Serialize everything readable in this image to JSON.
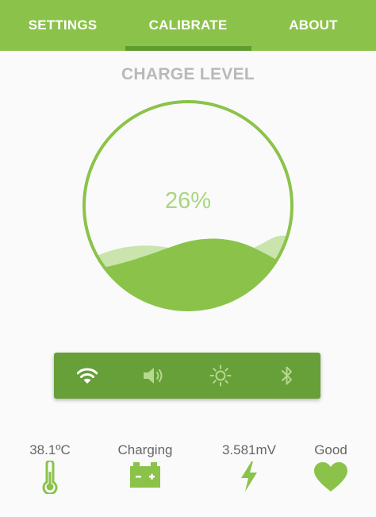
{
  "tabs": [
    {
      "label": "SETTINGS"
    },
    {
      "label": "CALIBRATE",
      "selected": true
    },
    {
      "label": "ABOUT"
    }
  ],
  "charge": {
    "title": "CHARGE LEVEL",
    "percent_text": "26%",
    "level": 0.26
  },
  "toggles": [
    {
      "icon": "wifi-icon",
      "active": true
    },
    {
      "icon": "volume-icon",
      "active": false
    },
    {
      "icon": "brightness-icon",
      "active": false
    },
    {
      "icon": "bluetooth-icon",
      "active": false
    }
  ],
  "status": {
    "temperature": {
      "value": "38.1ºC",
      "icon": "thermometer-icon"
    },
    "state": {
      "value": "Charging",
      "icon": "battery-icon"
    },
    "voltage": {
      "value": "3.581mV",
      "icon": "lightning-icon"
    },
    "health": {
      "value": "Good",
      "icon": "heart-icon"
    }
  },
  "colors": {
    "primary": "#8bc34a",
    "primary_dark": "#679f38",
    "indicator": "#5e9b30",
    "wave_front": "#8bc34a",
    "wave_back": "#c9e4ad",
    "toggle_inactive": "#b4d98f",
    "title_gray": "#b9b9b9"
  }
}
